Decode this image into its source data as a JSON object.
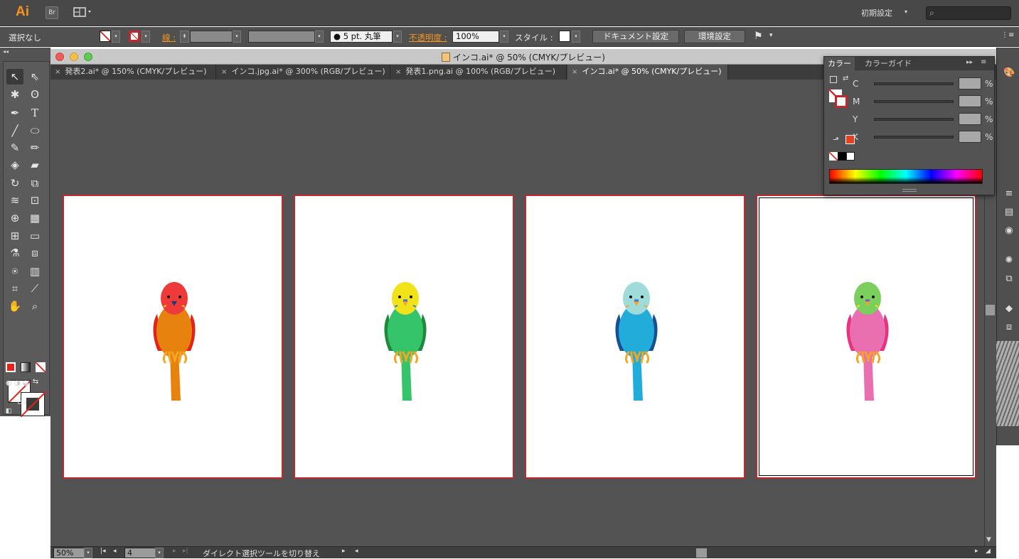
{
  "menubar": {
    "app_logo": "Ai",
    "bridge_label": "Br",
    "arrange_icon": "layout-icon",
    "workspace": "初期設定",
    "search_icon": "search-icon"
  },
  "control_bar": {
    "selection": "選択なし",
    "stroke_label": "線 :",
    "brush": "5 pt. 丸筆",
    "opacity_label": "不透明度 :",
    "opacity_value": "100%",
    "style_label": "スタイル :",
    "doc_settings": "ドキュメント設定",
    "preferences": "環境設定"
  },
  "document": {
    "title": "インコ.ai* @ 50% (CMYK/プレビュー)",
    "tabs": [
      {
        "label": "発表2.ai* @ 150% (CMYK/プレビュー)"
      },
      {
        "label": "インコ.jpg.ai* @ 300% (RGB/プレビュー)"
      },
      {
        "label": "発表1.png.ai @ 100% (RGB/プレビュー)"
      },
      {
        "label": "インコ.ai* @ 50% (CMYK/プレビュー)"
      }
    ],
    "active_tab": 3
  },
  "artboards": [
    {
      "name": "red-parakeet",
      "head": "#ef3a3a",
      "body": "#e8820e",
      "wings": "#e2231a",
      "tail": "#e8820e",
      "face": "#ef3a3a"
    },
    {
      "name": "green-parakeet",
      "head": "#f2e21a",
      "body": "#35c46a",
      "wings": "#1f8a3e",
      "tail": "#35c46a",
      "face": "#f2e21a"
    },
    {
      "name": "blue-parakeet",
      "head": "#9edbd9",
      "body": "#22acd9",
      "wings": "#174f93",
      "tail": "#22acd9",
      "face": "#9edbd9"
    },
    {
      "name": "pink-parakeet",
      "head": "#7bcf5d",
      "body": "#ea6fb0",
      "wings": "#e8317f",
      "tail": "#ea6fb0",
      "face": "#7bcf5d"
    }
  ],
  "color_panel": {
    "tabs": [
      "カラー",
      "カラーガイド"
    ],
    "channels": [
      {
        "label": "C",
        "pct": "%"
      },
      {
        "label": "M",
        "pct": "%"
      },
      {
        "label": "Y",
        "pct": "%"
      },
      {
        "label": "K",
        "pct": "%"
      }
    ],
    "out_of_gamut_color": "#e8401f"
  },
  "status_bar": {
    "zoom": "50%",
    "artboard_number": "4",
    "tool_status": "ダイレクト選択ツールを切り替え"
  },
  "colors": {
    "accent": "#f7941d",
    "artboard_border": "#c1282d"
  }
}
